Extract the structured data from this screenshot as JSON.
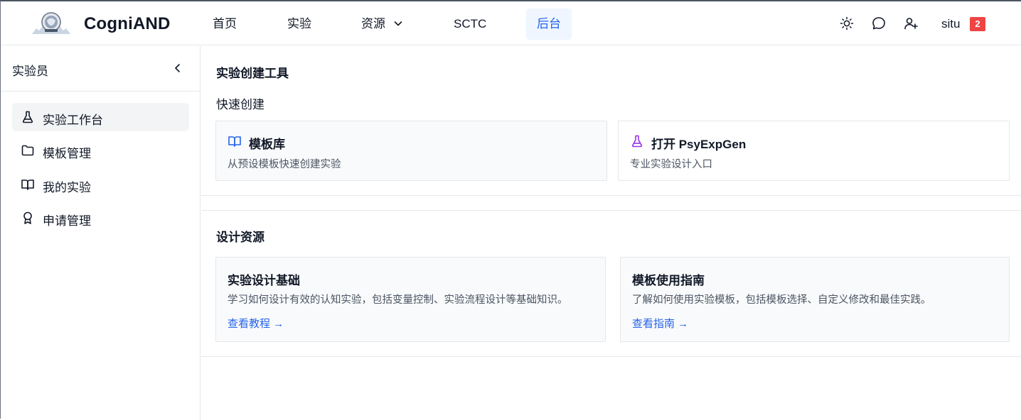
{
  "header": {
    "brand": "CogniAND",
    "nav": [
      {
        "label": "首页"
      },
      {
        "label": "实验"
      },
      {
        "label": "资源"
      },
      {
        "label": "SCTC"
      },
      {
        "label": "后台"
      }
    ],
    "icons": [
      "sun-icon",
      "chat-bubble-icon",
      "user-plus-icon"
    ],
    "user": "situ",
    "badge": "2"
  },
  "sidebar": {
    "title": "实验员",
    "items": [
      {
        "label": "实验工作台",
        "icon": "flask-icon"
      },
      {
        "label": "模板管理",
        "icon": "folder-icon"
      },
      {
        "label": "我的实验",
        "icon": "book-open-icon"
      },
      {
        "label": "申请管理",
        "icon": "award-icon"
      }
    ]
  },
  "main": {
    "tools": {
      "title": "实验创建工具",
      "subtitle": "快速创建",
      "cards": [
        {
          "title": "模板库",
          "desc": "从预设模板快速创建实验",
          "icon": "book-open-icon"
        },
        {
          "title": "打开 PsyExpGen",
          "desc": "专业实验设计入口",
          "icon": "flask-icon"
        }
      ]
    },
    "resources": {
      "title": "设计资源",
      "cards": [
        {
          "title": "实验设计基础",
          "desc": "学习如何设计有效的认知实验，包括变量控制、实验流程设计等基础知识。",
          "link": "查看教程 →"
        },
        {
          "title": "模板使用指南",
          "desc": "了解如何使用实验模板，包括模板选择、自定义修改和最佳实践。",
          "link": "查看指南 →"
        }
      ]
    }
  },
  "colors": {
    "accent": "#2563eb",
    "active_nav_bg": "#eff6ff",
    "badge": "#ef4444",
    "flask_purple": "#9333ea"
  }
}
